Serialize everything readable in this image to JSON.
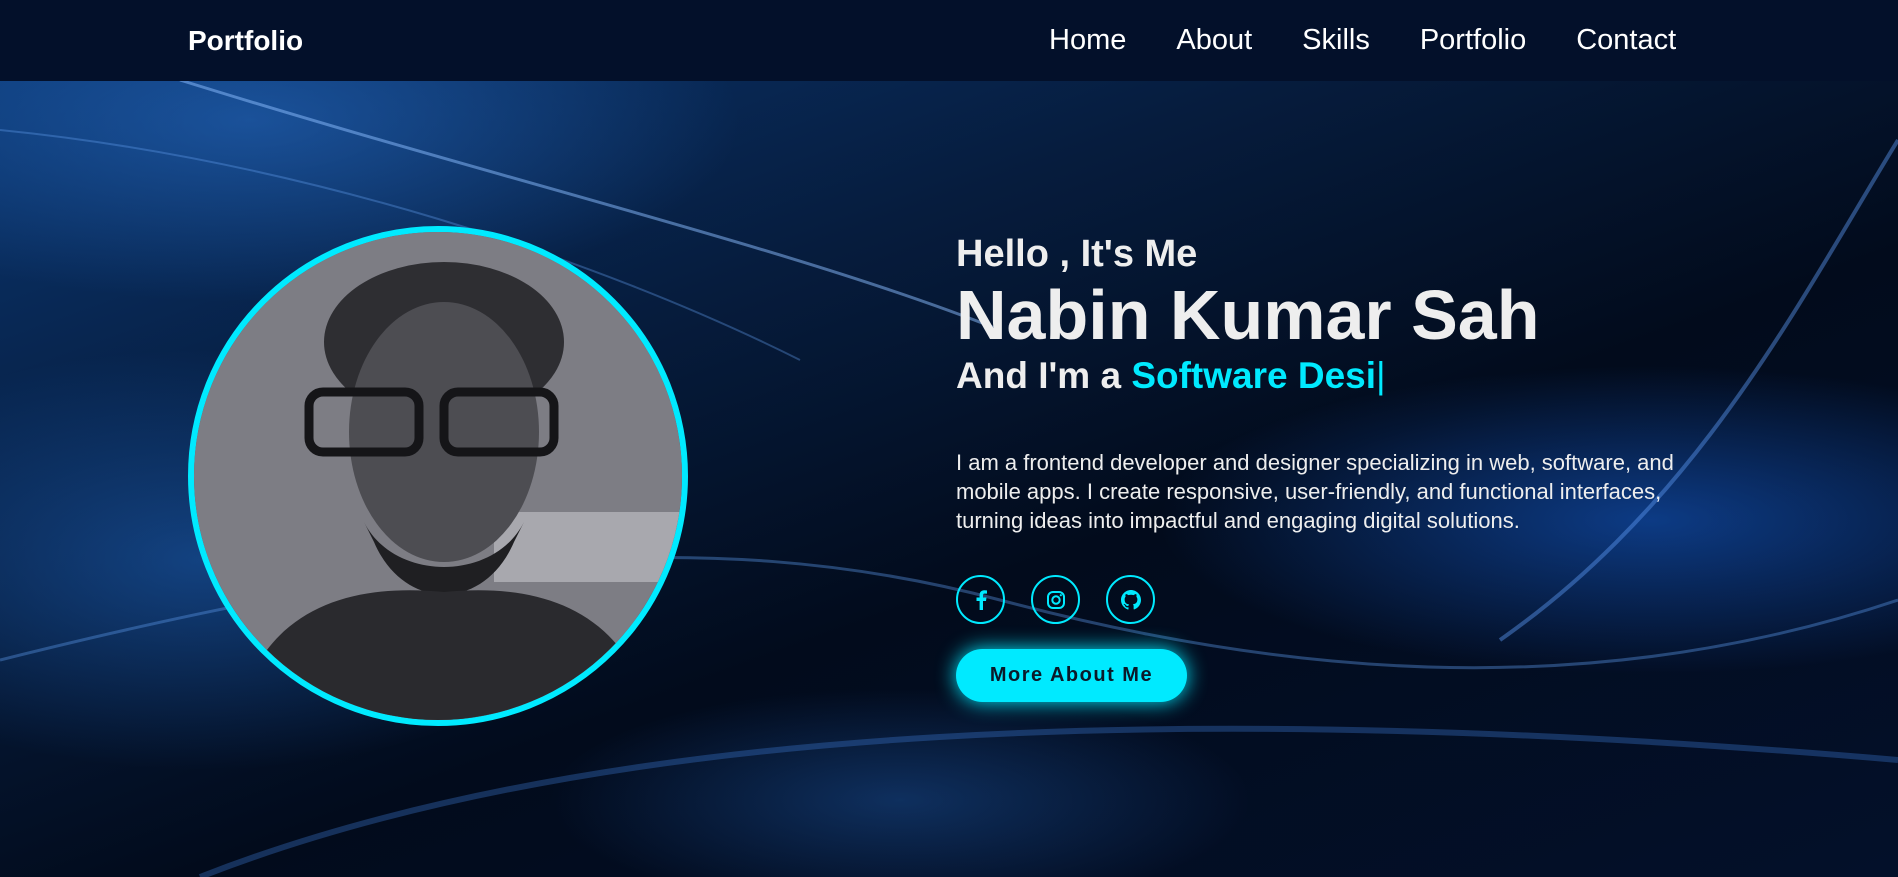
{
  "nav": {
    "logo": "Portfolio",
    "links": [
      "Home",
      "About",
      "Skills",
      "Portfolio",
      "Contact"
    ]
  },
  "hero": {
    "greeting": "Hello , It's Me",
    "name": "Nabin Kumar Sah",
    "role_prefix": "And I'm a ",
    "role_typed": "Software Desi",
    "caret": "|",
    "description": "I am a frontend developer and designer specializing in web, software, and mobile apps. I create responsive, user-friendly, and functional interfaces, turning ideas into impactful and engaging digital solutions.",
    "socials": [
      "facebook-icon",
      "instagram-icon",
      "github-icon"
    ],
    "button": "More About Me"
  },
  "colors": {
    "accent": "#00eaff",
    "nav_bg": "#03102a"
  }
}
